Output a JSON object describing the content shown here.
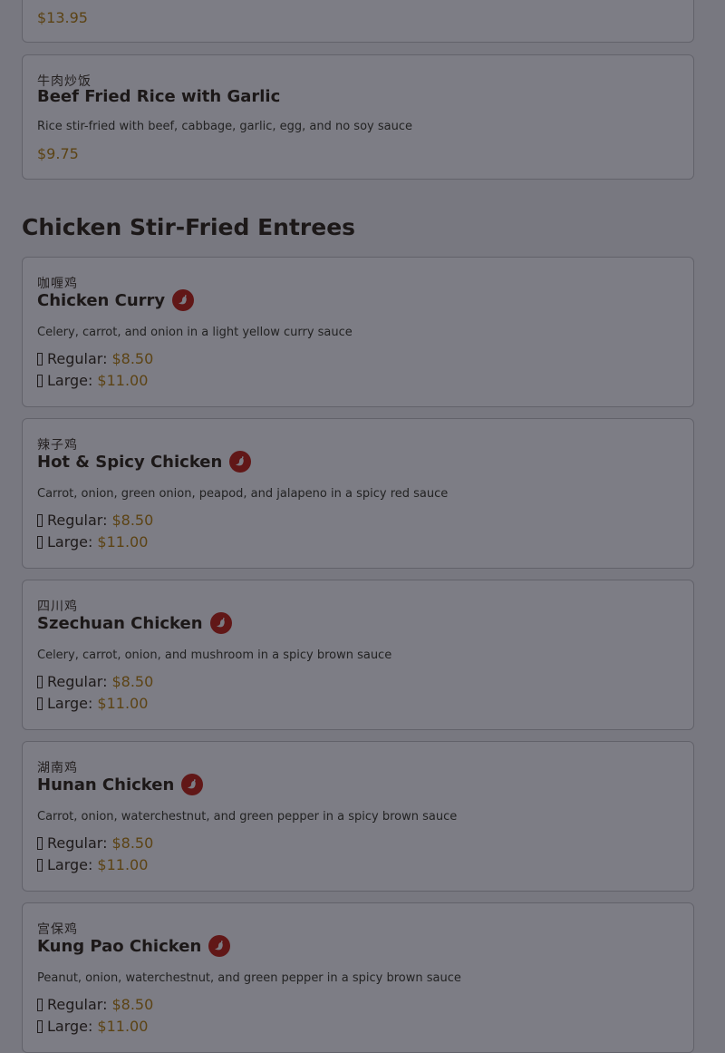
{
  "prev_item": {
    "price": "$13.95"
  },
  "beef_fried_rice": {
    "chinese_name": "牛肉炒饭",
    "name": "Beef Fried Rice with Garlic",
    "description": "Rice stir-fried with beef, cabbage, garlic, egg, and no soy sauce",
    "price": "$9.75"
  },
  "section": {
    "title": "Chicken Stir-Fried Entrees"
  },
  "size_labels": {
    "regular": "Regular:",
    "large": "Large:"
  },
  "items": [
    {
      "chinese_name": "咖喱鸡",
      "name": "Chicken Curry",
      "spicy": true,
      "description": "Celery, carrot, and onion in a light yellow curry sauce",
      "regular_price": "$8.50",
      "large_price": "$11.00"
    },
    {
      "chinese_name": "辣子鸡",
      "name": "Hot & Spicy Chicken",
      "spicy": true,
      "description": "Carrot, onion, green onion, peapod, and jalapeno in a spicy red sauce",
      "regular_price": "$8.50",
      "large_price": "$11.00"
    },
    {
      "chinese_name": "四川鸡",
      "name": "Szechuan Chicken",
      "spicy": true,
      "description": "Celery, carrot, onion, and mushroom in a spicy brown sauce",
      "regular_price": "$8.50",
      "large_price": "$11.00"
    },
    {
      "chinese_name": "湖南鸡",
      "name": "Hunan Chicken",
      "spicy": true,
      "description": "Carrot, onion, waterchestnut, and green pepper in a spicy brown sauce",
      "regular_price": "$8.50",
      "large_price": "$11.00"
    },
    {
      "chinese_name": "宫保鸡",
      "name": "Kung Pao Chicken",
      "spicy": true,
      "description": "Peanut, onion, waterchestnut, and green pepper in a spicy brown sauce",
      "regular_price": "$8.50",
      "large_price": "$11.00"
    }
  ],
  "colors": {
    "chili_badge": "#611717",
    "price": "#5c4314",
    "overlay": "#787880"
  }
}
